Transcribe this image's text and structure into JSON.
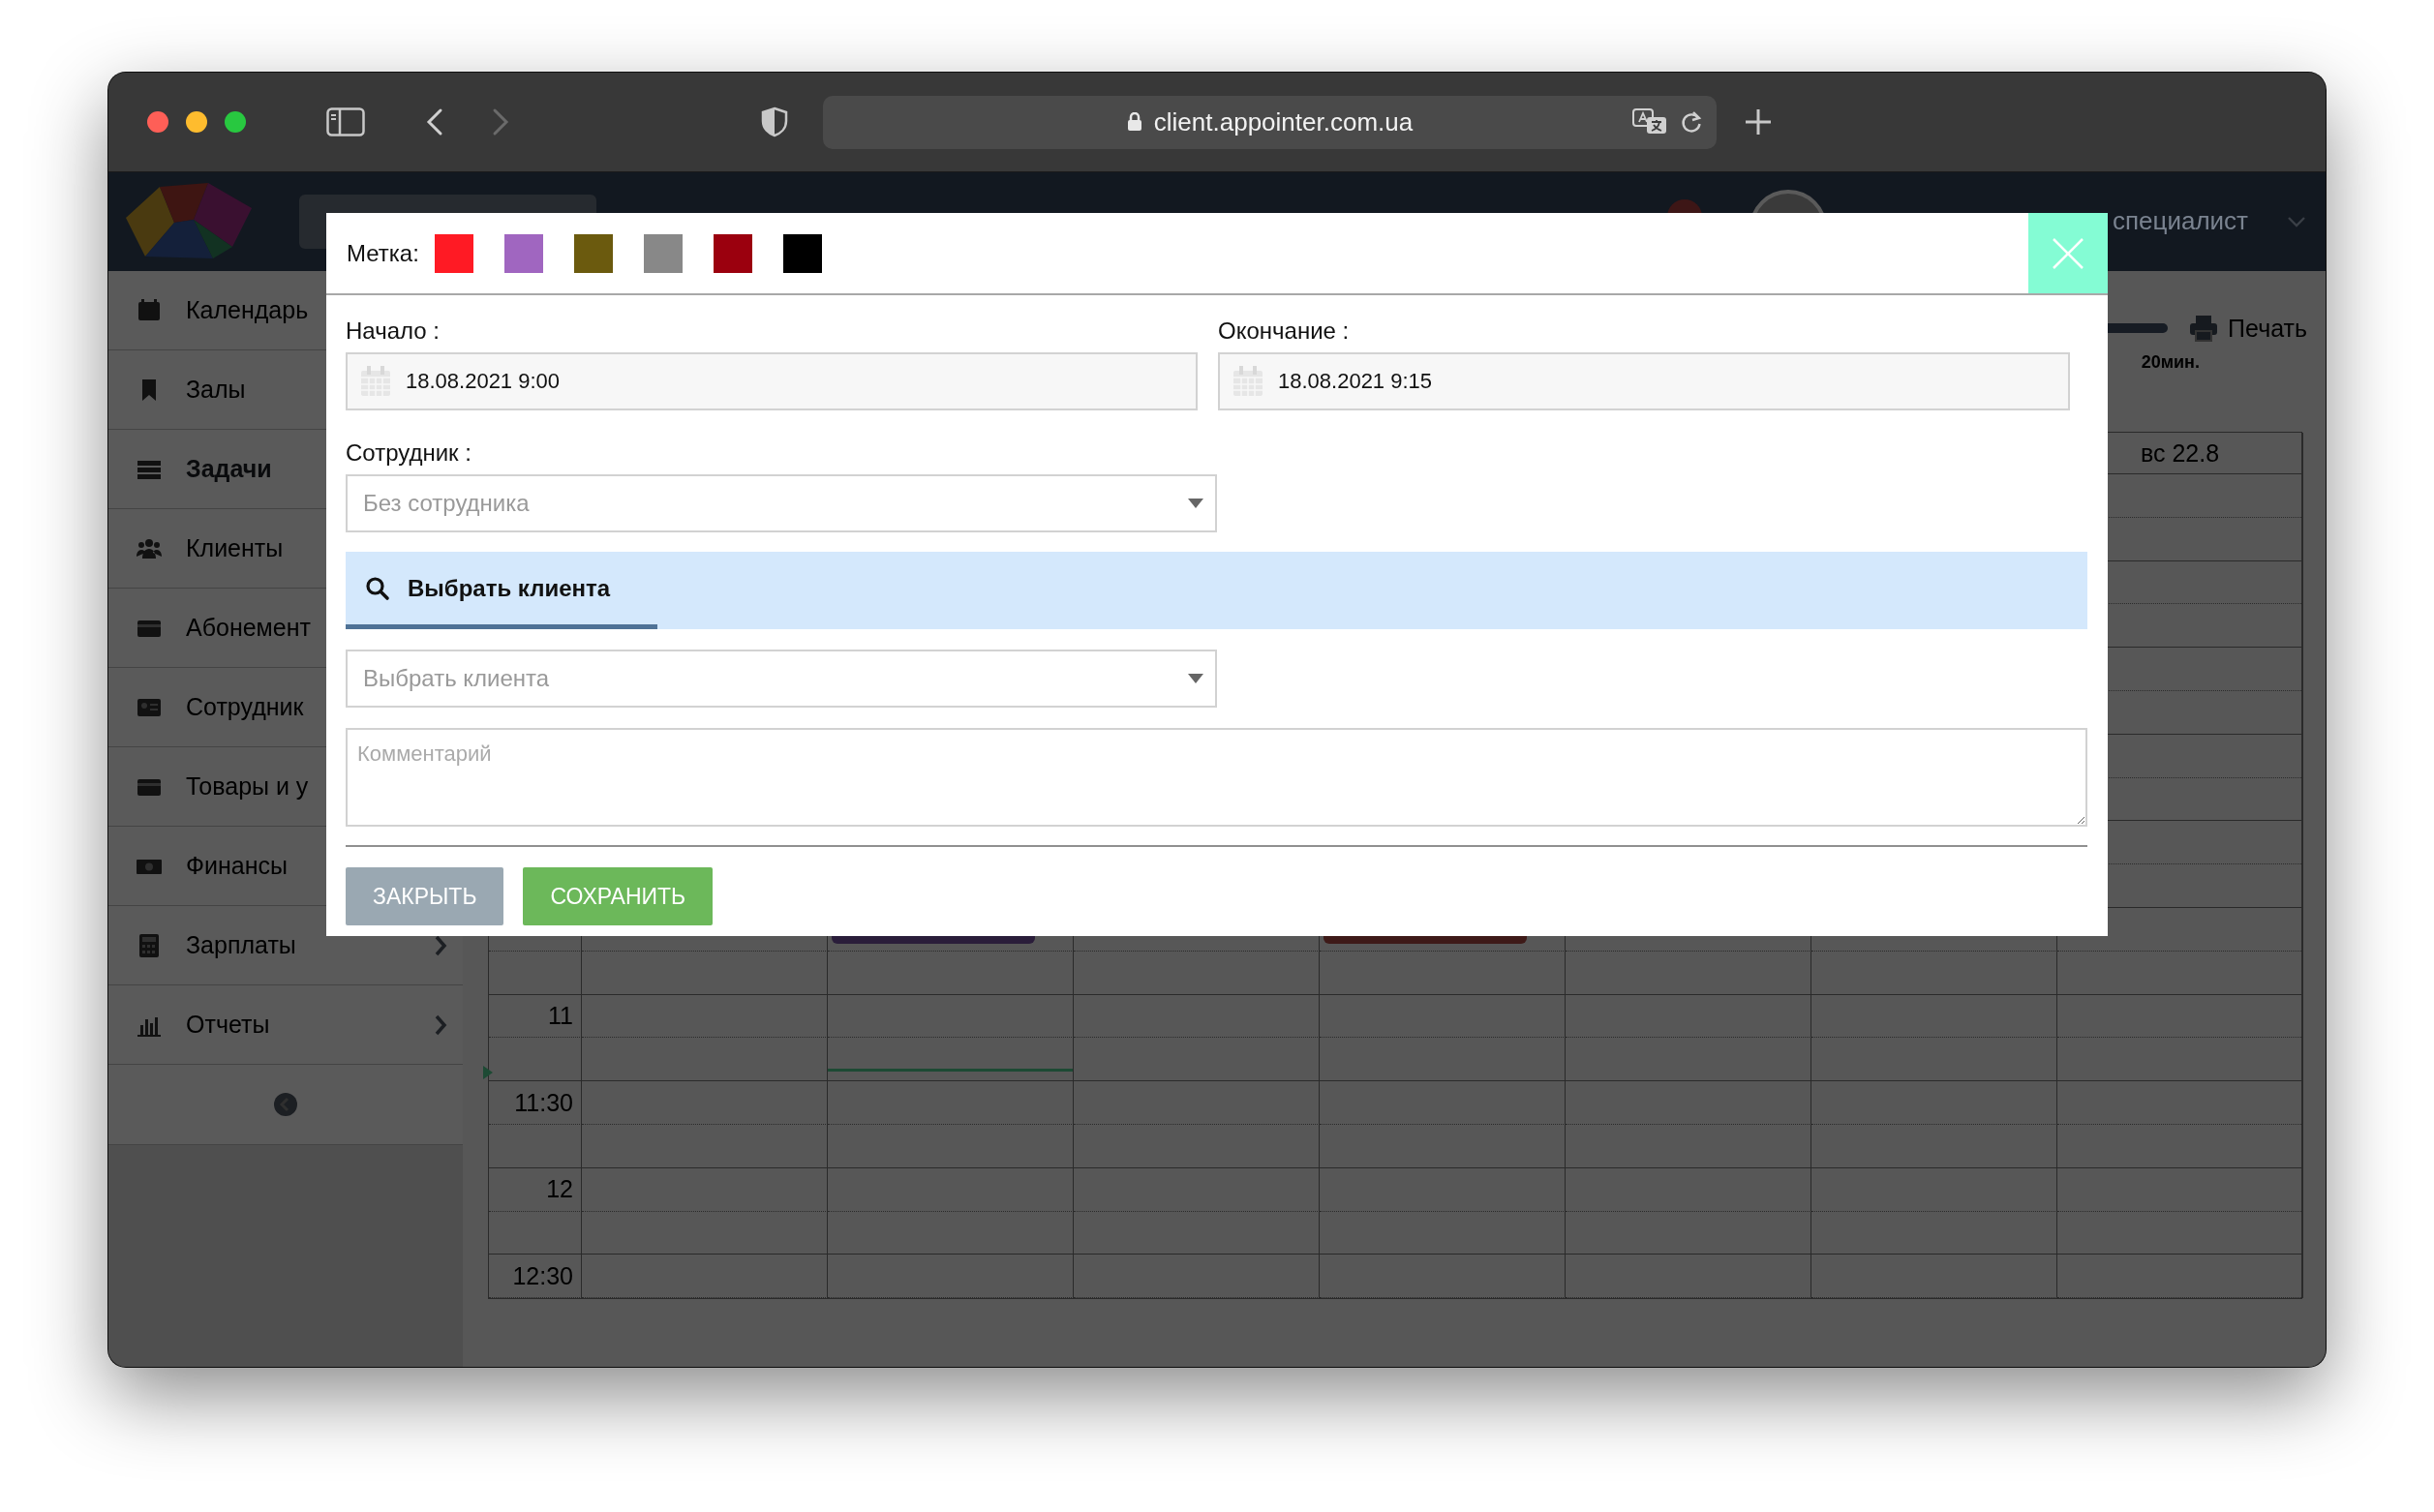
{
  "browser": {
    "url": "client.appointer.com.ua"
  },
  "app_header": {
    "user_role": "специалист"
  },
  "sidebar": {
    "items": [
      {
        "label": "Календарь",
        "selected": false
      },
      {
        "label": "Залы",
        "selected": false
      },
      {
        "label": "Задачи",
        "selected": true
      },
      {
        "label": "Клиенты",
        "selected": false
      },
      {
        "label": "Абонемент",
        "selected": false
      },
      {
        "label": "Сотрудник",
        "selected": false
      },
      {
        "label": "Товары и у",
        "selected": false
      },
      {
        "label": "Финансы",
        "selected": false
      },
      {
        "label": "Зарплаты",
        "selected": false,
        "has_submenu": true
      },
      {
        "label": "Отчеты",
        "selected": false,
        "has_submenu": true
      }
    ]
  },
  "toolbar": {
    "print": "Печать",
    "slot_duration": "20мин."
  },
  "calendar": {
    "day_header": "вс 22.8",
    "times": [
      "11",
      "11:30",
      "12",
      "12:30"
    ]
  },
  "modal": {
    "label_title": "Метка:",
    "colors": [
      {
        "color": "#ff1a24"
      },
      {
        "color": "#a066c0"
      },
      {
        "color": "#6b5a0e"
      },
      {
        "color": "#888888"
      },
      {
        "color": "#9b000e"
      },
      {
        "color": "#000000"
      }
    ],
    "start": {
      "label": "Начало :",
      "value": "18.08.2021 9:00"
    },
    "end": {
      "label": "Окончание :",
      "value": "18.08.2021 9:15"
    },
    "employee": {
      "label": "Сотрудник :",
      "placeholder": "Без сотрудника"
    },
    "tabs": [
      {
        "label": "Выбрать клиента",
        "selected": true
      }
    ],
    "client": {
      "placeholder": "Выбрать клиента"
    },
    "comment": {
      "placeholder": "Комментарий"
    },
    "buttons": [
      {
        "label": "ЗАКРЫТЬ",
        "kind": "secondary"
      },
      {
        "label": "СОХРАНИТЬ",
        "kind": "primary"
      }
    ]
  }
}
